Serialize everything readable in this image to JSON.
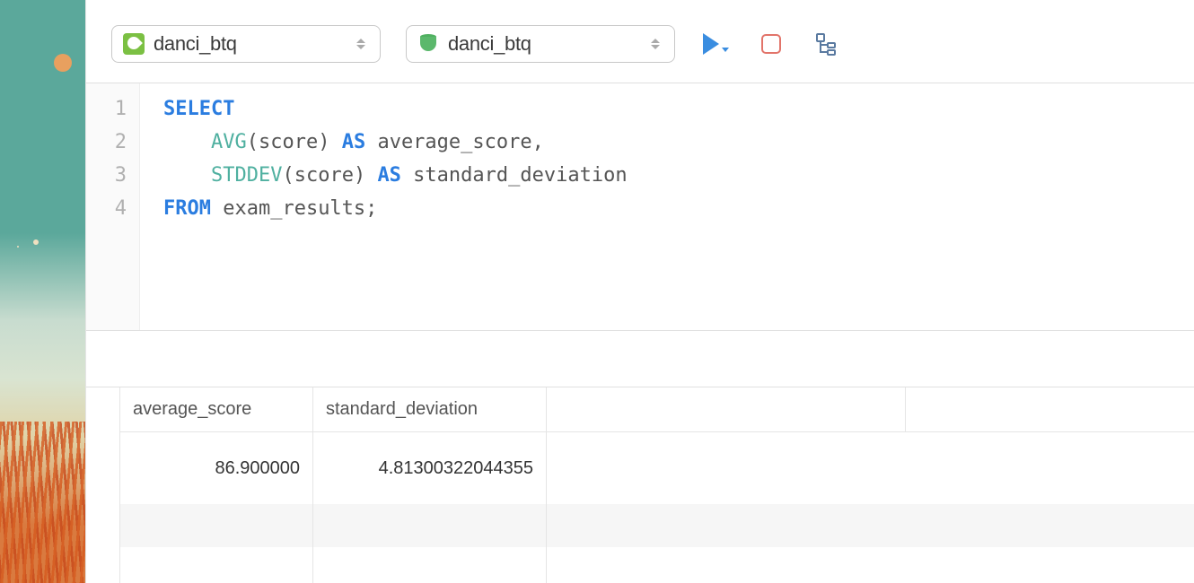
{
  "toolbar": {
    "connection_selector": "danci_btq",
    "database_selector": "danci_btq"
  },
  "editor": {
    "line_numbers": [
      "1",
      "2",
      "3",
      "4"
    ],
    "code": {
      "kw_select": "SELECT",
      "fn_avg": "AVG",
      "t_avg_args": "(score) ",
      "kw_as1": "AS",
      "t_avg_alias": " average_score,",
      "fn_stddev": "STDDEV",
      "t_stddev_args": "(score) ",
      "kw_as2": "AS",
      "t_stddev_alias": " standard_deviation",
      "kw_from": "FROM",
      "t_table": " exam_results;"
    }
  },
  "results": {
    "columns": [
      "average_score",
      "standard_deviation"
    ],
    "rows": [
      {
        "average_score": "86.900000",
        "standard_deviation": "4.81300322044355"
      }
    ]
  }
}
